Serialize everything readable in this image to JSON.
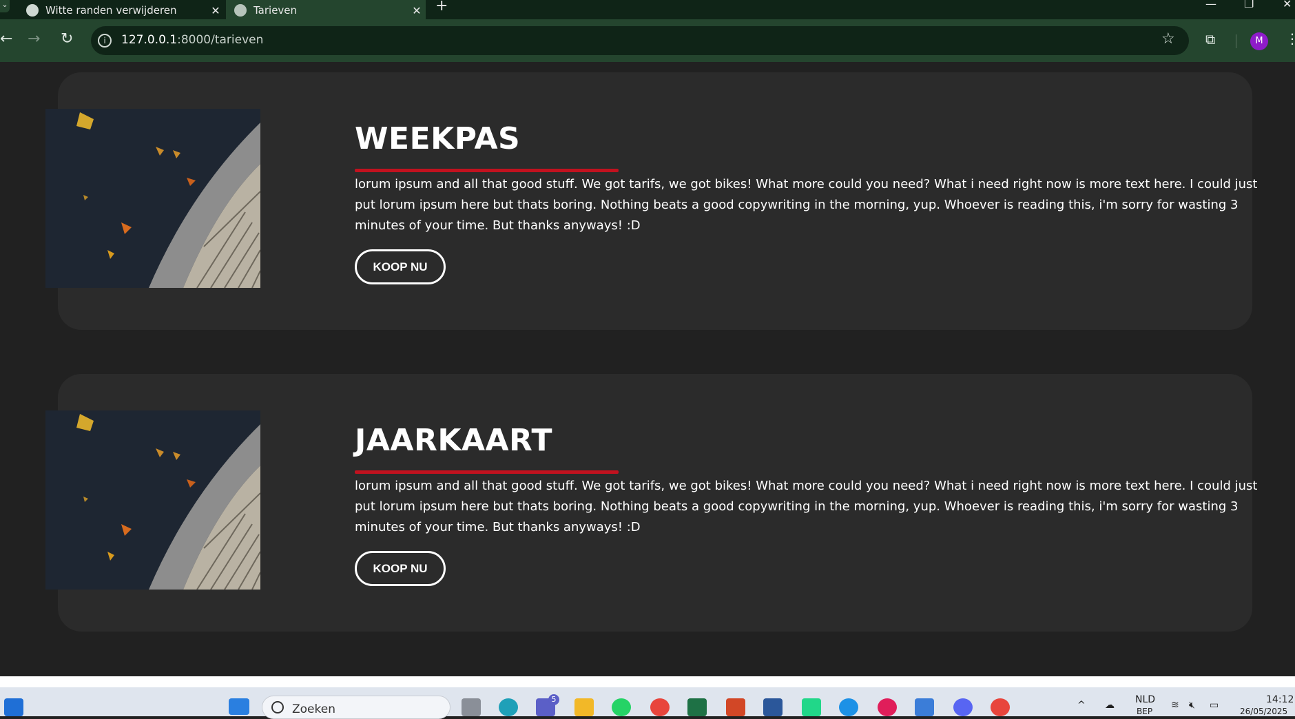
{
  "browser": {
    "tabs": [
      {
        "title": "Witte randen verwijderen",
        "active": false
      },
      {
        "title": "Tarieven",
        "active": true
      }
    ],
    "url_host": "127.0.0.1",
    "url_rest": ":8000/tarieven",
    "profile_initial": "M"
  },
  "cards": [
    {
      "title": "WEEKPAS",
      "text": "lorum ipsum and all that good stuff. We got tarifs, we got bikes! What more could you need? What i need right now is more text here. I could just put lorum ipsum here but thats boring. Nothing beats a good copywriting in the morning, yup. Whoever is reading this, i'm sorry for wasting 3 minutes of your time. But thanks anyways! :D",
      "button": "KOOP NU"
    },
    {
      "title": "JAARKAART",
      "text": "lorum ipsum and all that good stuff. We got tarifs, we got bikes! What more could you need? What i need right now is more text here. I could just put lorum ipsum here but thats boring. Nothing beats a good copywriting in the morning, yup. Whoever is reading this, i'm sorry for wasting 3 minutes of your time. But thanks anyways! :D",
      "button": "KOOP NU"
    }
  ],
  "taskbar": {
    "search_label": "Zoeken",
    "teams_badge": "5",
    "language": "NLD",
    "language_sub": "BEP",
    "time": "14:12",
    "date": "26/05/2025"
  },
  "colors": {
    "accent": "#c1121f",
    "card_bg": "#2b2b2b",
    "page_bg": "#212121",
    "chrome_bg": "#24452e"
  }
}
